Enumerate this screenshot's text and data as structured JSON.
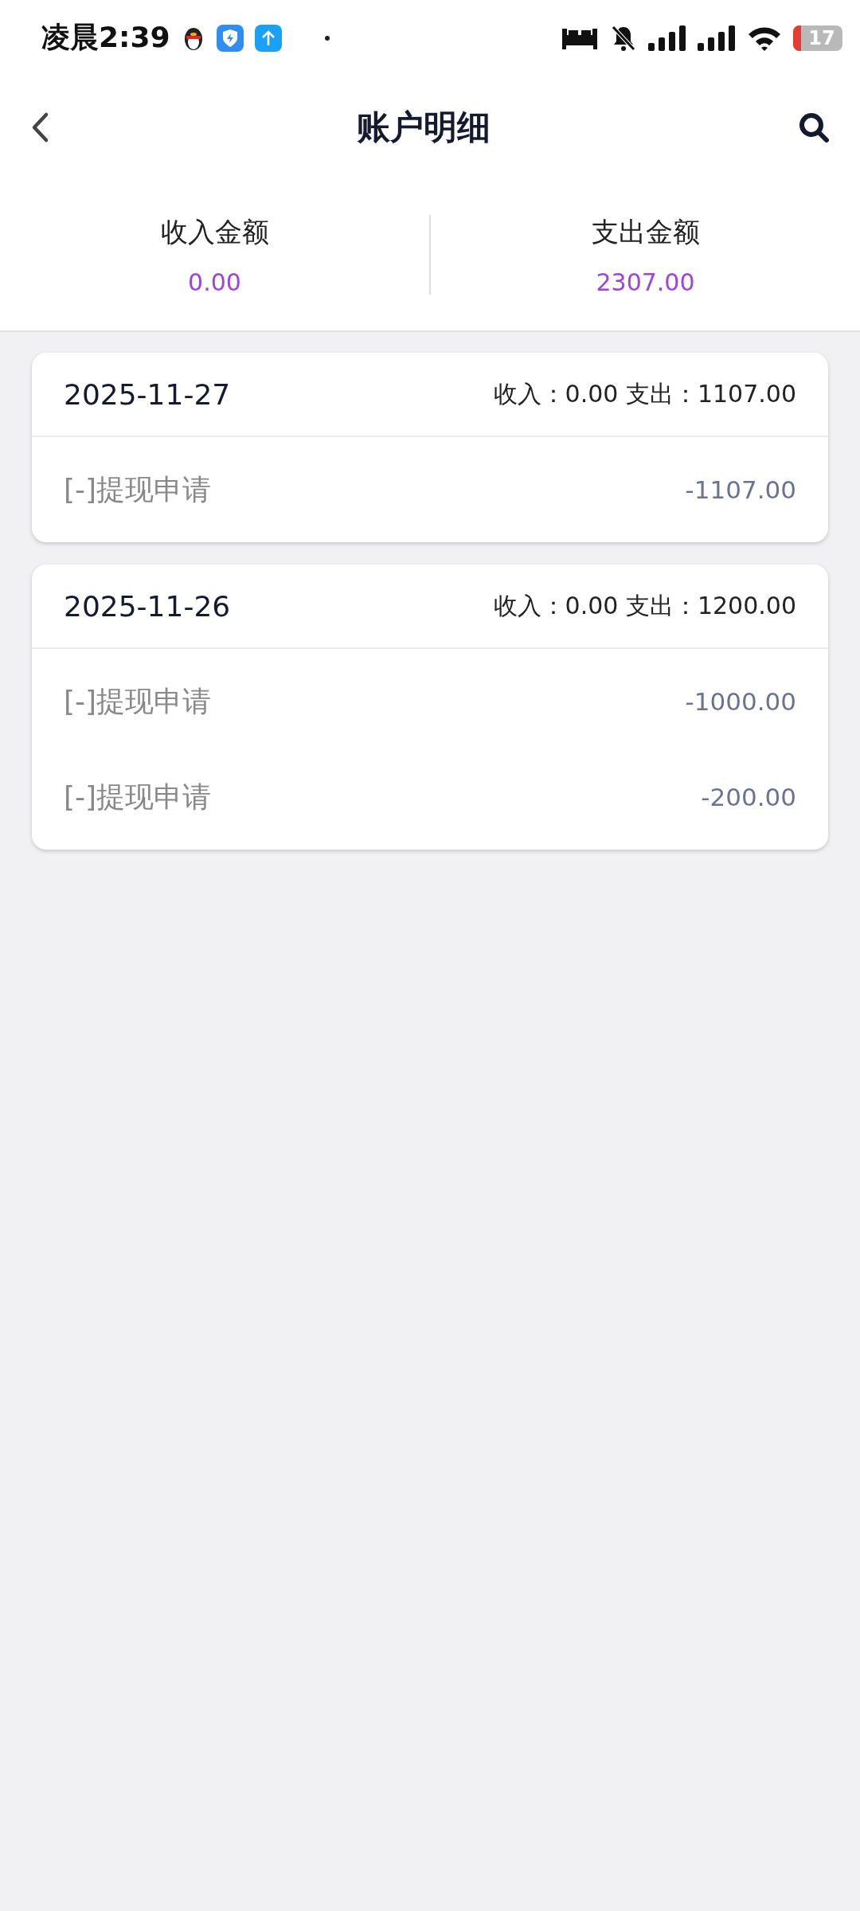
{
  "status_bar": {
    "time": "凌晨2:39",
    "battery": "17"
  },
  "header": {
    "title": "账户明细"
  },
  "summary": [
    {
      "label": "收入金额",
      "value": "0.00"
    },
    {
      "label": "支出金额",
      "value": "2307.00"
    }
  ],
  "days": [
    {
      "date": "2025-11-27",
      "totals": "收入：0.00 支出：1107.00",
      "entries": [
        {
          "title": "[-]提现申请",
          "amount": "-1107.00"
        }
      ]
    },
    {
      "date": "2025-11-26",
      "totals": "收入：0.00 支出：1200.00",
      "entries": [
        {
          "title": "[-]提现申请",
          "amount": "-1000.00"
        },
        {
          "title": "[-]提现申请",
          "amount": "-200.00"
        }
      ]
    }
  ]
}
